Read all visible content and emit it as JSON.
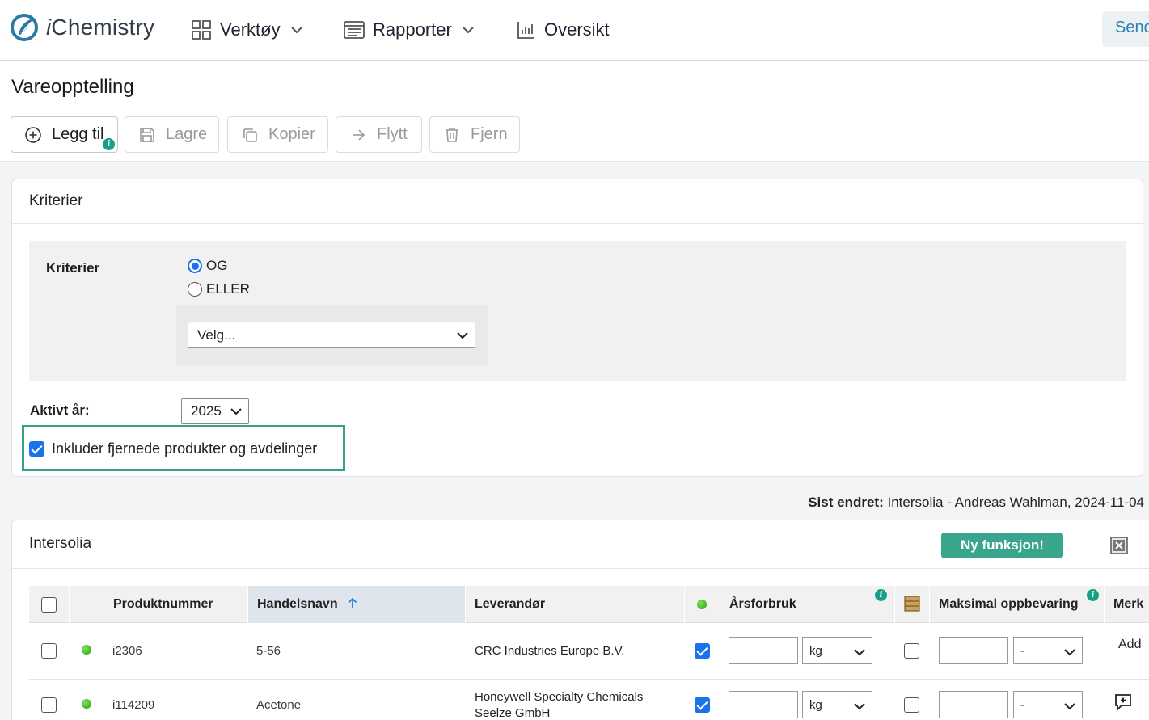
{
  "app": {
    "brand_prefix": "i",
    "brand_name": "Chemistry"
  },
  "nav": {
    "tools": "Verktøy",
    "reports": "Rapporter",
    "overview": "Oversikt",
    "send": "Send"
  },
  "page": {
    "title": "Vareopptelling"
  },
  "toolbar": {
    "add": "Legg til",
    "save": "Lagre",
    "copy": "Kopier",
    "move": "Flytt",
    "remove": "Fjern",
    "info": "i"
  },
  "criteria": {
    "panel_title": "Kriterier",
    "label": "Kriterier",
    "and": "OG",
    "or": "ELLER",
    "selected_operator": "OG",
    "select_placeholder": "Velg...",
    "year_label": "Aktivt år:",
    "year_value": "2025",
    "include_removed_label": "Inkluder fjernede produkter og avdelinger",
    "include_removed_checked": true
  },
  "last_changed": {
    "label": "Sist endret:",
    "value": "Intersolia - Andreas Wahlman, 2024-11-04"
  },
  "table_panel": {
    "title": "Intersolia",
    "new_feature_button": "Ny funksjon!",
    "columns": {
      "product_number": "Produktnummer",
      "trade_name": "Handelsnavn",
      "supplier": "Leverandør",
      "annual_usage": "Årsforbruk",
      "max_storage": "Maksimal oppbevaring",
      "notes": "Merk"
    },
    "sort_column": "trade_name",
    "sort_direction": "ascending",
    "rows": [
      {
        "product_number": "i2306",
        "trade_name": "5-56",
        "supplier_line1": "CRC Industries Europe B.V.",
        "supplier_line2": "",
        "active": true,
        "unit": "kg",
        "storage_unit": "-",
        "note_action": "Add"
      },
      {
        "product_number": "i114209",
        "trade_name": "Acetone",
        "supplier_line1": "Honeywell Specialty Chemicals",
        "supplier_line2": "Seelze GmbH",
        "active": true,
        "unit": "kg",
        "storage_unit": "-",
        "note_action": ""
      }
    ]
  },
  "colors": {
    "accent": "#3aa58d",
    "primary": "#1a73e8",
    "link": "#2a7fb3",
    "highlight_border": "#3a9e8b"
  }
}
